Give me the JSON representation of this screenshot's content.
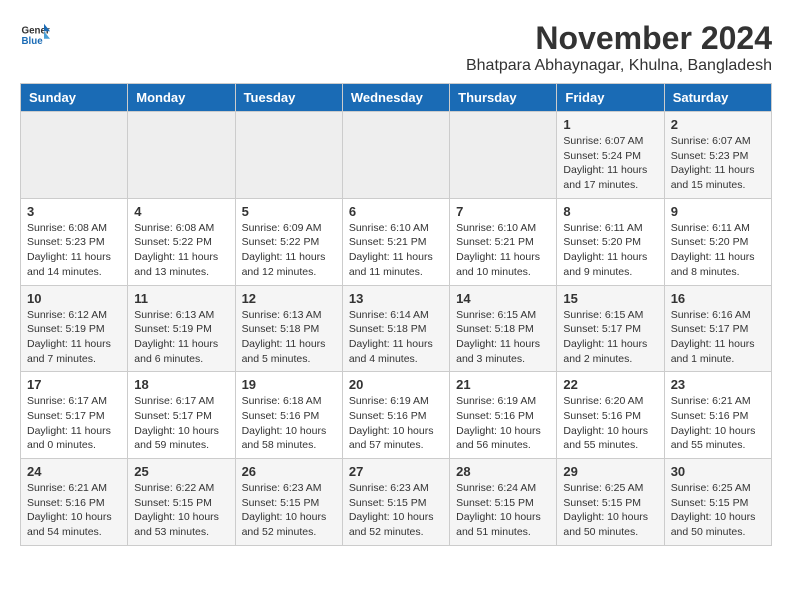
{
  "header": {
    "logo_general": "General",
    "logo_blue": "Blue",
    "month_title": "November 2024",
    "location": "Bhatpara Abhaynagar, Khulna, Bangladesh"
  },
  "days_of_week": [
    "Sunday",
    "Monday",
    "Tuesday",
    "Wednesday",
    "Thursday",
    "Friday",
    "Saturday"
  ],
  "weeks": [
    [
      {
        "day": "",
        "info": ""
      },
      {
        "day": "",
        "info": ""
      },
      {
        "day": "",
        "info": ""
      },
      {
        "day": "",
        "info": ""
      },
      {
        "day": "",
        "info": ""
      },
      {
        "day": "1",
        "info": "Sunrise: 6:07 AM\nSunset: 5:24 PM\nDaylight: 11 hours and 17 minutes."
      },
      {
        "day": "2",
        "info": "Sunrise: 6:07 AM\nSunset: 5:23 PM\nDaylight: 11 hours and 15 minutes."
      }
    ],
    [
      {
        "day": "3",
        "info": "Sunrise: 6:08 AM\nSunset: 5:23 PM\nDaylight: 11 hours and 14 minutes."
      },
      {
        "day": "4",
        "info": "Sunrise: 6:08 AM\nSunset: 5:22 PM\nDaylight: 11 hours and 13 minutes."
      },
      {
        "day": "5",
        "info": "Sunrise: 6:09 AM\nSunset: 5:22 PM\nDaylight: 11 hours and 12 minutes."
      },
      {
        "day": "6",
        "info": "Sunrise: 6:10 AM\nSunset: 5:21 PM\nDaylight: 11 hours and 11 minutes."
      },
      {
        "day": "7",
        "info": "Sunrise: 6:10 AM\nSunset: 5:21 PM\nDaylight: 11 hours and 10 minutes."
      },
      {
        "day": "8",
        "info": "Sunrise: 6:11 AM\nSunset: 5:20 PM\nDaylight: 11 hours and 9 minutes."
      },
      {
        "day": "9",
        "info": "Sunrise: 6:11 AM\nSunset: 5:20 PM\nDaylight: 11 hours and 8 minutes."
      }
    ],
    [
      {
        "day": "10",
        "info": "Sunrise: 6:12 AM\nSunset: 5:19 PM\nDaylight: 11 hours and 7 minutes."
      },
      {
        "day": "11",
        "info": "Sunrise: 6:13 AM\nSunset: 5:19 PM\nDaylight: 11 hours and 6 minutes."
      },
      {
        "day": "12",
        "info": "Sunrise: 6:13 AM\nSunset: 5:18 PM\nDaylight: 11 hours and 5 minutes."
      },
      {
        "day": "13",
        "info": "Sunrise: 6:14 AM\nSunset: 5:18 PM\nDaylight: 11 hours and 4 minutes."
      },
      {
        "day": "14",
        "info": "Sunrise: 6:15 AM\nSunset: 5:18 PM\nDaylight: 11 hours and 3 minutes."
      },
      {
        "day": "15",
        "info": "Sunrise: 6:15 AM\nSunset: 5:17 PM\nDaylight: 11 hours and 2 minutes."
      },
      {
        "day": "16",
        "info": "Sunrise: 6:16 AM\nSunset: 5:17 PM\nDaylight: 11 hours and 1 minute."
      }
    ],
    [
      {
        "day": "17",
        "info": "Sunrise: 6:17 AM\nSunset: 5:17 PM\nDaylight: 11 hours and 0 minutes."
      },
      {
        "day": "18",
        "info": "Sunrise: 6:17 AM\nSunset: 5:17 PM\nDaylight: 10 hours and 59 minutes."
      },
      {
        "day": "19",
        "info": "Sunrise: 6:18 AM\nSunset: 5:16 PM\nDaylight: 10 hours and 58 minutes."
      },
      {
        "day": "20",
        "info": "Sunrise: 6:19 AM\nSunset: 5:16 PM\nDaylight: 10 hours and 57 minutes."
      },
      {
        "day": "21",
        "info": "Sunrise: 6:19 AM\nSunset: 5:16 PM\nDaylight: 10 hours and 56 minutes."
      },
      {
        "day": "22",
        "info": "Sunrise: 6:20 AM\nSunset: 5:16 PM\nDaylight: 10 hours and 55 minutes."
      },
      {
        "day": "23",
        "info": "Sunrise: 6:21 AM\nSunset: 5:16 PM\nDaylight: 10 hours and 55 minutes."
      }
    ],
    [
      {
        "day": "24",
        "info": "Sunrise: 6:21 AM\nSunset: 5:16 PM\nDaylight: 10 hours and 54 minutes."
      },
      {
        "day": "25",
        "info": "Sunrise: 6:22 AM\nSunset: 5:15 PM\nDaylight: 10 hours and 53 minutes."
      },
      {
        "day": "26",
        "info": "Sunrise: 6:23 AM\nSunset: 5:15 PM\nDaylight: 10 hours and 52 minutes."
      },
      {
        "day": "27",
        "info": "Sunrise: 6:23 AM\nSunset: 5:15 PM\nDaylight: 10 hours and 52 minutes."
      },
      {
        "day": "28",
        "info": "Sunrise: 6:24 AM\nSunset: 5:15 PM\nDaylight: 10 hours and 51 minutes."
      },
      {
        "day": "29",
        "info": "Sunrise: 6:25 AM\nSunset: 5:15 PM\nDaylight: 10 hours and 50 minutes."
      },
      {
        "day": "30",
        "info": "Sunrise: 6:25 AM\nSunset: 5:15 PM\nDaylight: 10 hours and 50 minutes."
      }
    ]
  ]
}
